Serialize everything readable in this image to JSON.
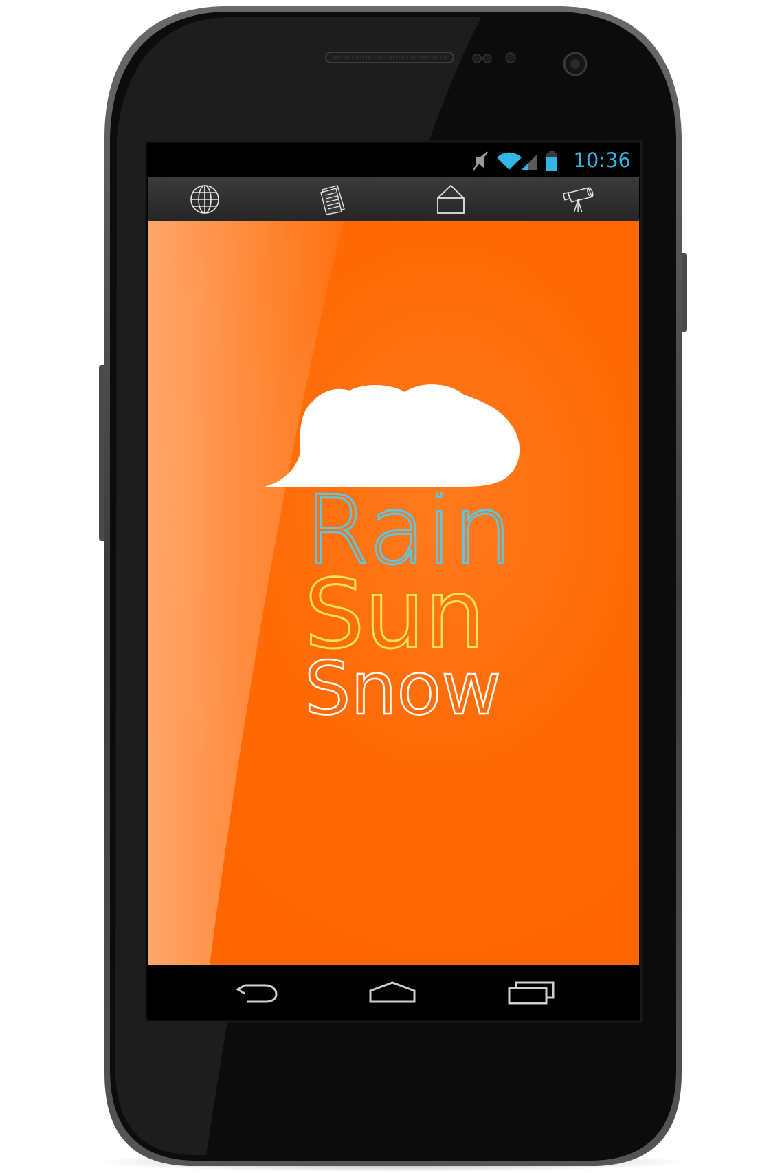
{
  "status_bar": {
    "time": "10:36",
    "icons": [
      "mute-icon",
      "wifi-icon",
      "signal-icon",
      "battery-icon"
    ],
    "accent_color": "#33b5e5"
  },
  "toolbar": {
    "items": [
      {
        "icon": "globe-icon"
      },
      {
        "icon": "document-icon"
      },
      {
        "icon": "house-icon"
      },
      {
        "icon": "telescope-icon"
      }
    ]
  },
  "splash": {
    "background_color": "#ff6600",
    "logo": "cloud-icon",
    "words": [
      {
        "text": "Rain",
        "color": "#5bc8e8"
      },
      {
        "text": "Sun",
        "color": "#ffe45a"
      },
      {
        "text": "Snow",
        "color": "#ffffff"
      }
    ]
  },
  "nav_bar": {
    "items": [
      {
        "icon": "back-icon"
      },
      {
        "icon": "home-icon"
      },
      {
        "icon": "recent-apps-icon"
      }
    ]
  }
}
